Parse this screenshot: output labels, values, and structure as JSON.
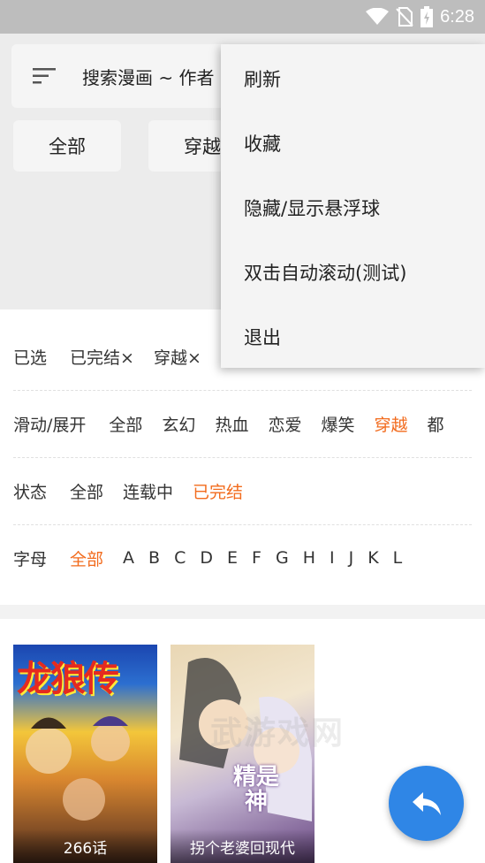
{
  "status_bar": {
    "time": "6:28",
    "icons": [
      "wifi-icon",
      "no-sim-icon",
      "battery-charging-icon"
    ]
  },
  "search": {
    "placeholder": "搜索漫画 ~ 作者"
  },
  "top_chips": [
    "全部",
    "穿越"
  ],
  "filters": {
    "selected": {
      "label": "已选",
      "items": [
        "已完结×",
        "穿越×"
      ]
    },
    "genre": {
      "label": "滑动/展开",
      "options": [
        "全部",
        "玄幻",
        "热血",
        "恋爱",
        "爆笑",
        "穿越",
        "都"
      ],
      "active": "穿越"
    },
    "status": {
      "label": "状态",
      "options": [
        "全部",
        "连载中",
        "已完结"
      ],
      "active": "已完结"
    },
    "letter": {
      "label": "字母",
      "options": [
        "全部",
        "A",
        "B",
        "C",
        "D",
        "E",
        "F",
        "G",
        "H",
        "I",
        "J",
        "K",
        "L"
      ],
      "active": "全部"
    }
  },
  "comics": [
    {
      "cover_title": "龙狼传",
      "caption": "266话"
    },
    {
      "cover_title": "精是神",
      "caption": "拐个老婆回现代"
    }
  ],
  "watermark": "武游戏网",
  "menu": {
    "items": [
      "刷新",
      "收藏",
      "隐藏/显示悬浮球",
      "双击自动滚动(测试)",
      "退出"
    ]
  },
  "colors": {
    "accent": "#f26b1d",
    "fab": "#2f86e6",
    "status_bar": "#bdbdbd"
  }
}
